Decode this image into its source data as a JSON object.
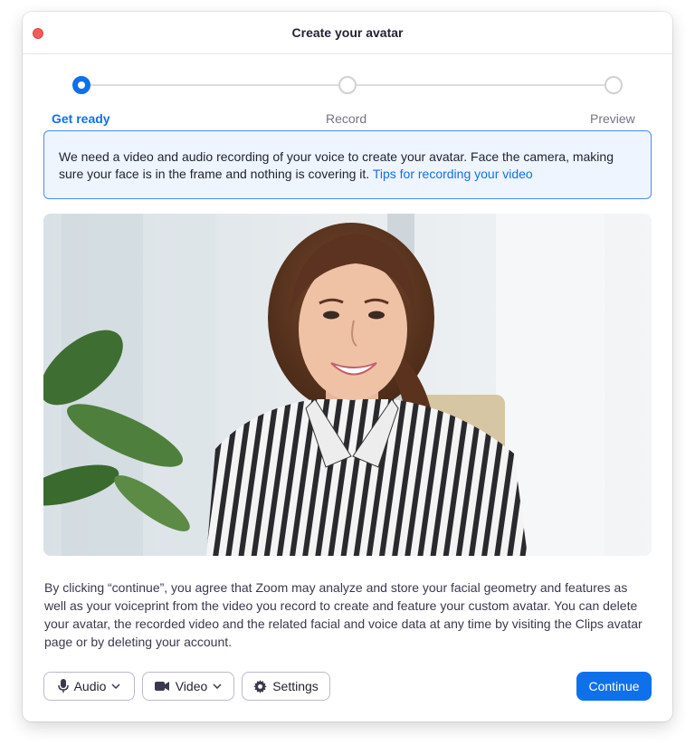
{
  "window": {
    "title": "Create your avatar"
  },
  "stepper": {
    "steps": [
      {
        "label": "Get ready",
        "state": "active"
      },
      {
        "label": "Record",
        "state": "pending"
      },
      {
        "label": "Preview",
        "state": "pending"
      }
    ]
  },
  "info": {
    "text": "We need a video and audio recording of your voice to create your avatar. Face the camera, making sure your face is in the frame and nothing is covering it.",
    "link": "Tips for recording your video"
  },
  "consent": {
    "text": "By clicking “continue”, you agree that Zoom may analyze and store your facial geometry and features as well as your voiceprint from the video you record to create and feature your custom avatar. You can delete your avatar, the recorded video and the related facial and voice data at any time by visiting the Clips avatar page or by deleting your account."
  },
  "controls": {
    "audio_label": "Audio",
    "video_label": "Video",
    "settings_label": "Settings",
    "continue_label": "Continue"
  },
  "colors": {
    "accent": "#0e71eb",
    "close": "#ee5f59",
    "banner_bg": "#eef5fe"
  },
  "icons": {
    "audio": "microphone-icon",
    "video": "video-camera-icon",
    "settings": "gear-icon",
    "dropdown": "chevron-down-icon"
  }
}
